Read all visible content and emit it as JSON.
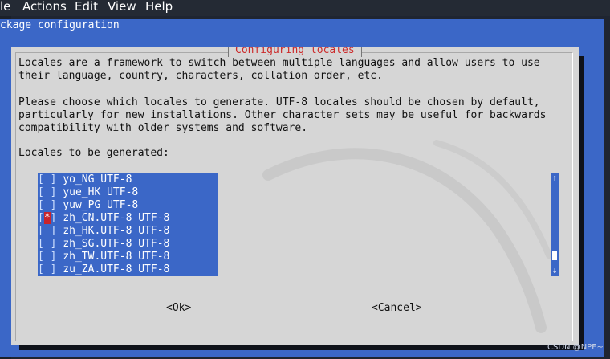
{
  "menubar": {
    "items": [
      "le",
      "Actions",
      "Edit",
      "View",
      "Help"
    ]
  },
  "terminal": {
    "backtitle": "ckage configuration"
  },
  "dialog": {
    "title": "Configuring locales",
    "intro": "Locales are a framework to switch between multiple languages and allow users to use\ntheir language, country, characters, collation order, etc.",
    "instructions": "Please choose which locales to generate. UTF-8 locales should be chosen by default,\nparticularly for new installations. Other character sets may be useful for backwards\ncompatibility with older systems and software.",
    "list_label": "Locales to be generated:",
    "locales": [
      {
        "mark": "[ ]",
        "name": "yo_NG UTF-8",
        "selected": false
      },
      {
        "mark": "[ ]",
        "name": "yue_HK UTF-8",
        "selected": false
      },
      {
        "mark": "[ ]",
        "name": "yuw_PG UTF-8",
        "selected": false
      },
      {
        "mark": "[*]",
        "name": "zh_CN.UTF-8 UTF-8",
        "selected": true
      },
      {
        "mark": "[ ]",
        "name": "zh_HK.UTF-8 UTF-8",
        "selected": false
      },
      {
        "mark": "[ ]",
        "name": "zh_SG.UTF-8 UTF-8",
        "selected": false
      },
      {
        "mark": "[ ]",
        "name": "zh_TW.UTF-8 UTF-8",
        "selected": false
      },
      {
        "mark": "[ ]",
        "name": "zu_ZA.UTF-8 UTF-8",
        "selected": false
      }
    ],
    "scroll_up": "↑",
    "scroll_down": "↓",
    "ok_label": "<Ok>",
    "cancel_label": "<Cancel>"
  },
  "watermark": "CSDN @NPE~",
  "colors": {
    "terminal_blue": "#3b67c7",
    "dialog_gray": "#d6d6d6",
    "title_red": "#cc2a2a",
    "mark_red": "#c9242b"
  }
}
